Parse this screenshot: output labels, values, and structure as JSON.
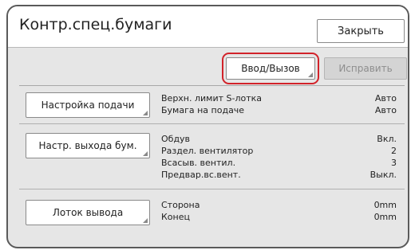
{
  "header": {
    "title": "Контр.спец.бумаги",
    "close_label": "Закрыть"
  },
  "toolbar": {
    "input_label": "Ввод/Вызов",
    "fix_label": "Исправить",
    "fix_disabled": true,
    "highlight_color": "#d2232a"
  },
  "sections": [
    {
      "button_label": "Настройка подачи",
      "rows": [
        {
          "label": "Верхн. лимит S-лотка",
          "value": "Авто"
        },
        {
          "label": "Бумага на подаче",
          "value": "Авто"
        }
      ]
    },
    {
      "button_label": "Настр. выхода бум.",
      "rows": [
        {
          "label": "Обдув",
          "value": "Вкл."
        },
        {
          "label": "Раздел. вентилятор",
          "value": "2"
        },
        {
          "label": "Всасыв. вентил.",
          "value": "3"
        },
        {
          "label": "Предвар.вс.вент.",
          "value": "Выкл."
        }
      ]
    },
    {
      "button_label": "Лоток вывода",
      "rows": [
        {
          "label": "Сторона",
          "value": "0mm"
        },
        {
          "label": "Конец",
          "value": "0mm"
        }
      ]
    }
  ]
}
